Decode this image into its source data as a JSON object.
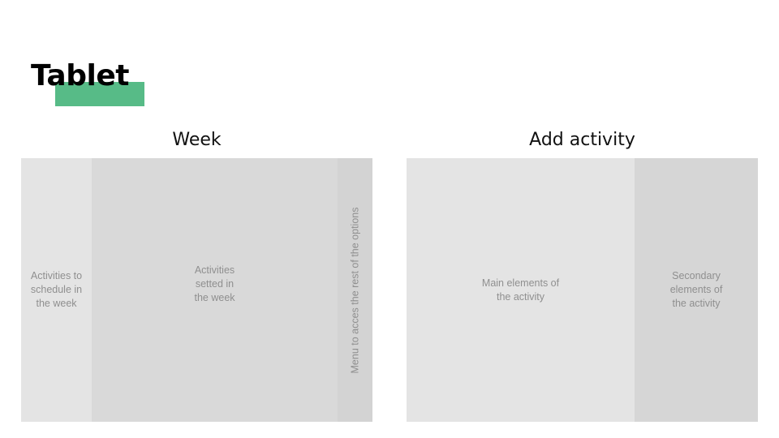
{
  "page": {
    "title": "Tablet",
    "accent_color": "#57bb87"
  },
  "week": {
    "title": "Week",
    "left_block": "Activities to\nschedule in\nthe week",
    "center_block": "Activities\nsetted in\nthe week",
    "menu_block": "Menu to acces the rest of the options"
  },
  "add_activity": {
    "title": "Add activity",
    "main_block": "Main elements of\nthe activity",
    "secondary_block": "Secondary\nelements of\nthe activity"
  },
  "colors": {
    "light_block": "#e4e4e4",
    "medium_block": "#d9d9d9",
    "dark_block": "#d3d3d3",
    "text": "#8f8f8f"
  }
}
